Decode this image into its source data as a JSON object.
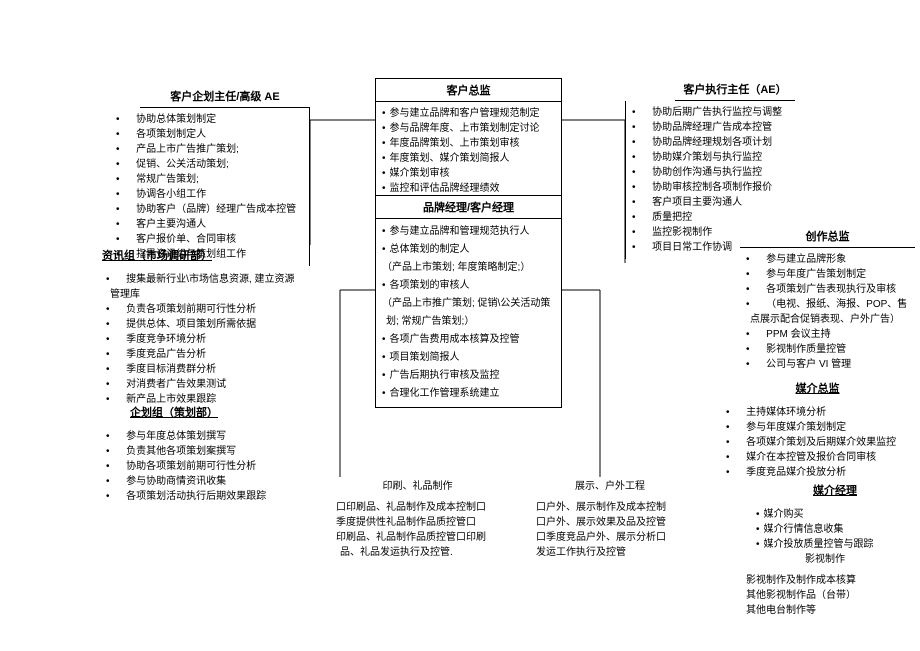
{
  "boxes": {
    "ae_senior": {
      "title": "客户企划主任/高级 AE",
      "items": [
        "协助总体策划制定",
        "各项策划制定人",
        "产品上市广告推广策划;",
        "促销、公关活动策划;",
        "常规广告策划;",
        "协调各小组工作",
        "协助客户（品牌）经理广告成本控管",
        "客户主要沟通人",
        "客户报价单、合同审核",
        "指导资讯组与策划组工作"
      ]
    },
    "director": {
      "title": "客户总监",
      "items": [
        "参与建立品牌和客户管理规范制定",
        "参与品牌年度、上市策划制定讨论",
        "年度品牌策划、上市策划审核",
        "年度策划、媒介策划简报人",
        "媒介策划审核",
        "监控和评估品牌经理绩效"
      ]
    },
    "exec_ae": {
      "title": "客户执行主任（AE）",
      "items": [
        "协助后期广告执行监控与调整",
        "协助品牌经理广告成本控管",
        "协助品牌经理规划各项计划",
        "协助媒介策划与执行监控",
        "协助创作沟通与执行监控",
        "协助审核控制各项制作报价",
        "客户项目主要沟通人",
        "质量把控",
        "监控影视制作",
        "项目日常工作协调"
      ]
    },
    "brand_mgr": {
      "title": "品牌经理/客户经理",
      "items": [
        "参与建立品牌和管理规范执行人",
        "总体策划的制定人",
        "（产品上市策划; 年度策略制定;）",
        "各项策划的审核人",
        "（产品上市推广策划; 促销\\公关活动策划; 常规广告策划;）",
        "各项广告费用成本核算及控管",
        "项目策划简报人",
        "广告后期执行审核及监控",
        "合理化工作管理系统建立"
      ]
    },
    "creative": {
      "title": "创作总监",
      "items": [
        "参与建立品牌形象",
        "参与年度广告策划制定",
        "各项策划广告表现执行及审核",
        "（电视、报纸、海报、POP、售点展示配合促销表现、户外广告）",
        "PPM 会议主持",
        "影视制作质量控管",
        "公司与客户 VI 管理"
      ]
    }
  },
  "info_group": {
    "title": "资讯组（市场调研部）",
    "items": [
      "搜集最新行业\\市场信息资源, 建立资源管理库",
      "负责各项策划前期可行性分析",
      "提供总体、项目策划所需依据",
      "季度竞争环境分析",
      "季度竞品广告分析",
      "季度目标消费群分析",
      "对消费者广告效果测试",
      "新产品上市效果跟踪"
    ]
  },
  "plan_group": {
    "title": "企划组（策划部）",
    "items": [
      "参与年度总体策划撰写",
      "负责其他各项策划案撰写",
      "协助各项策划前期可行性分析",
      "参与协助商情资讯收集",
      "各项策划活动执行后期效果跟踪"
    ]
  },
  "media_director": {
    "title": "媒介总监",
    "items": [
      "主持媒体环境分析",
      "参与年度媒介策划制定",
      "各项媒介策划及后期媒介效果监控",
      "媒介在本控管及报价合同审核",
      "季度竞品媒介投放分析"
    ]
  },
  "media_mgr": {
    "title": "媒介经理",
    "items": [
      "媒介购买",
      "媒介行情信息收集",
      "媒介投放质量控管与跟踪"
    ]
  },
  "print": {
    "title": "印刷、礼品制作",
    "items": [
      "口印刷品、礼品制作及成本控制口",
      "季度提供性礼品制作品质控管口",
      "印刷品、礼品制作品质控管口印刷品、礼品发运执行及控管."
    ]
  },
  "outdoor": {
    "title": "展示、户外工程",
    "items": [
      "口户外、展示制作及成本控制",
      "口户外、展示效果及品及控管",
      "口季度竞品户外、展示分析口",
      "发运工作执行及控管"
    ]
  },
  "video": {
    "title": "影视制作",
    "items": [
      "影视制作及制作成本核算",
      "其他影视制作品（台带）",
      "其他电台制作等"
    ]
  }
}
